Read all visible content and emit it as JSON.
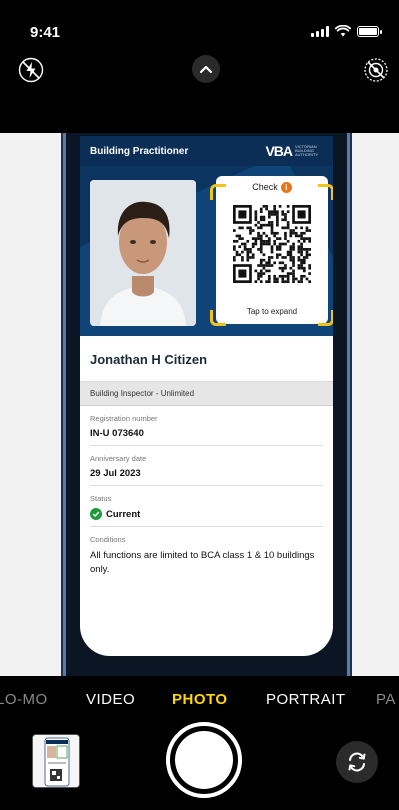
{
  "status_bar": {
    "time": "9:41"
  },
  "card": {
    "title": "Building Practitioner",
    "logo_text": "VBA",
    "logo_subtext": "VICTORIAN BUILDING AUTHORITY",
    "qr_check_label": "Check",
    "qr_check_icon": "i",
    "qr_tap_label": "Tap to expand",
    "holder_name": "Jonathan H Citizen",
    "role": "Building Inspector - Unlimited",
    "fields": [
      {
        "label": "Registration number",
        "value": "IN-U 073640"
      },
      {
        "label": "Anniversary date",
        "value": "29 Jul 2023"
      },
      {
        "label": "Status",
        "value": "Current"
      },
      {
        "label": "Conditions",
        "value": "All functions are limited to BCA class 1 & 10 buildings only."
      }
    ]
  },
  "camera": {
    "modes": [
      "LO-MO",
      "VIDEO",
      "PHOTO",
      "PORTRAIT",
      "PA"
    ],
    "active_mode": "PHOTO"
  },
  "colors": {
    "active_mode": "#ffd60a",
    "card_header": "#0b2e57",
    "qr_bracket": "#f2c31b",
    "status_ok": "#1f9a3b"
  }
}
